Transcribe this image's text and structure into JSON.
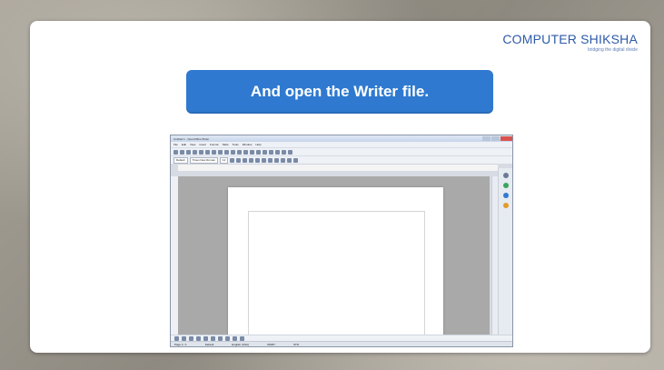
{
  "logo": {
    "name": "COMPUTER SHIKSHA",
    "tagline": "bridging the digital divide"
  },
  "banner": {
    "text": "And open the Writer file."
  },
  "screenshot": {
    "window_title": "Untitled 1 - OpenOffice Writer",
    "menu": [
      "File",
      "Edit",
      "View",
      "Insert",
      "Format",
      "Table",
      "Tools",
      "Window",
      "Help"
    ],
    "style_value": "Default",
    "font_value": "Times New Roman",
    "size_value": "12",
    "status": {
      "page": "Page 1 / 1",
      "style": "Default",
      "language": "English (USA)",
      "mode": "INSRT",
      "selection": "STD"
    }
  }
}
